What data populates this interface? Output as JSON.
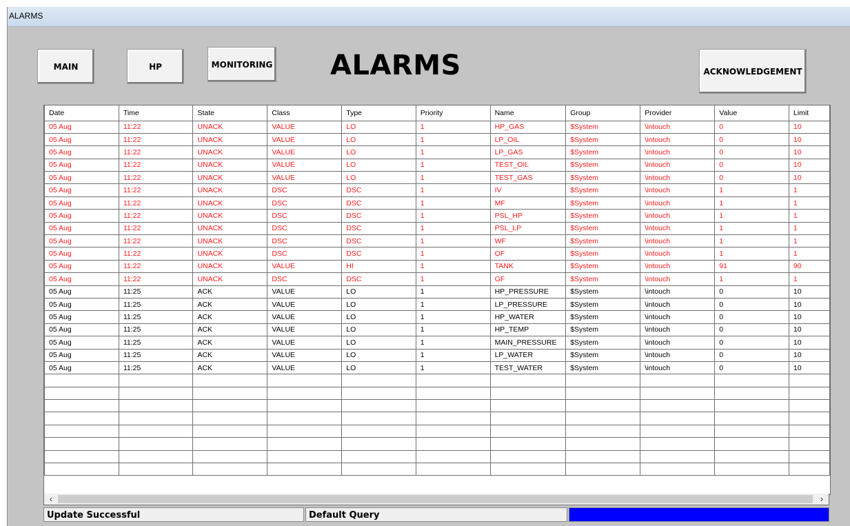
{
  "window": {
    "title": "ALARMS"
  },
  "nav": {
    "main_label": "MAIN",
    "hp_label": "HP",
    "monitoring_label": "MONITORING",
    "ack_label": "ACKNOWLEDGEMENT"
  },
  "page_title": "ALARMS",
  "colors": {
    "unack": "#ff1a1a",
    "ack": "#000000",
    "progress": "#0000ff"
  },
  "table": {
    "columns": [
      "Date",
      "Time",
      "State",
      "Class",
      "Type",
      "Priority",
      "Name",
      "Group",
      "Provider",
      "Value",
      "Limit"
    ],
    "rows": [
      [
        "05 Aug",
        "11:22",
        "UNACK",
        "VALUE",
        "LO",
        "1",
        "HP_GAS",
        "$System",
        "\\intouch",
        "0",
        "10"
      ],
      [
        "05 Aug",
        "11:22",
        "UNACK",
        "VALUE",
        "LO",
        "1",
        "LP_OIL",
        "$System",
        "\\intouch",
        "0",
        "10"
      ],
      [
        "05 Aug",
        "11:22",
        "UNACK",
        "VALUE",
        "LO",
        "1",
        "LP_GAS",
        "$System",
        "\\intouch",
        "0",
        "10"
      ],
      [
        "05 Aug",
        "11:22",
        "UNACK",
        "VALUE",
        "LO",
        "1",
        "TEST_OIL",
        "$System",
        "\\intouch",
        "0",
        "10"
      ],
      [
        "05 Aug",
        "11:22",
        "UNACK",
        "VALUE",
        "LO",
        "1",
        "TEST_GAS",
        "$System",
        "\\intouch",
        "0",
        "10"
      ],
      [
        "05 Aug",
        "11:22",
        "UNACK",
        "DSC",
        "DSC",
        "1",
        "IV",
        "$System",
        "\\intouch",
        "1",
        "1"
      ],
      [
        "05 Aug",
        "11:22",
        "UNACK",
        "DSC",
        "DSC",
        "1",
        "MF",
        "$System",
        "\\intouch",
        "1",
        "1"
      ],
      [
        "05 Aug",
        "11:22",
        "UNACK",
        "DSC",
        "DSC",
        "1",
        "PSL_HP",
        "$System",
        "\\intouch",
        "1",
        "1"
      ],
      [
        "05 Aug",
        "11:22",
        "UNACK",
        "DSC",
        "DSC",
        "1",
        "PSL_LP",
        "$System",
        "\\intouch",
        "1",
        "1"
      ],
      [
        "05 Aug",
        "11:22",
        "UNACK",
        "DSC",
        "DSC",
        "1",
        "WF",
        "$System",
        "\\intouch",
        "1",
        "1"
      ],
      [
        "05 Aug",
        "11:22",
        "UNACK",
        "DSC",
        "DSC",
        "1",
        "OF",
        "$System",
        "\\intouch",
        "1",
        "1"
      ],
      [
        "05 Aug",
        "11:22",
        "UNACK",
        "VALUE",
        "HI",
        "1",
        "TANK",
        "$System",
        "\\intouch",
        "91",
        "90"
      ],
      [
        "05 Aug",
        "11:22",
        "UNACK",
        "DSC",
        "DSC",
        "1",
        "GF",
        "$System",
        "\\intouch",
        "1",
        "1"
      ],
      [
        "05 Aug",
        "11:25",
        "ACK",
        "VALUE",
        "LO",
        "1",
        "HP_PRESSURE",
        "$System",
        "\\intouch",
        "0",
        "10"
      ],
      [
        "05 Aug",
        "11:25",
        "ACK",
        "VALUE",
        "LO",
        "1",
        "LP_PRESSURE",
        "$System",
        "\\intouch",
        "0",
        "10"
      ],
      [
        "05 Aug",
        "11:25",
        "ACK",
        "VALUE",
        "LO",
        "1",
        "HP_WATER",
        "$System",
        "\\intouch",
        "0",
        "10"
      ],
      [
        "05 Aug",
        "11:25",
        "ACK",
        "VALUE",
        "LO",
        "1",
        "HP_TEMP",
        "$System",
        "\\intouch",
        "0",
        "10"
      ],
      [
        "05 Aug",
        "11:25",
        "ACK",
        "VALUE",
        "LO",
        "1",
        "MAIN_PRESSURE",
        "$System",
        "\\intouch",
        "0",
        "10"
      ],
      [
        "05 Aug",
        "11:25",
        "ACK",
        "VALUE",
        "LO",
        "1",
        "LP_WATER",
        "$System",
        "\\intouch",
        "0",
        "10"
      ],
      [
        "05 Aug",
        "11:25",
        "ACK",
        "VALUE",
        "LO",
        "1",
        "TEST_WATER",
        "$System",
        "\\intouch",
        "0",
        "10"
      ]
    ],
    "empty_rows": 8
  },
  "scrollbar": {
    "left_arrow": "‹",
    "right_arrow": "›"
  },
  "status": {
    "update_text": "Update Successful",
    "query_text": "Default Query",
    "progress_fraction": 1.0
  }
}
